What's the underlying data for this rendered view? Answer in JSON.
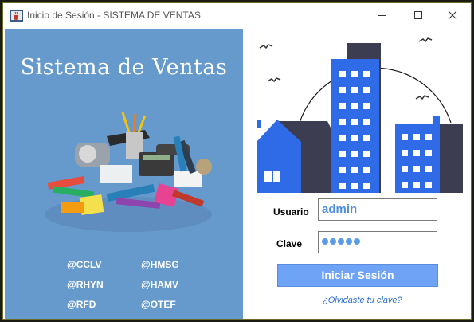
{
  "window": {
    "title": "Inicio de Sesión - SISTEMA DE VENTAS",
    "icon": "java-cup-icon",
    "controls": [
      "minimize-icon",
      "maximize-icon",
      "close-icon"
    ]
  },
  "left_panel": {
    "heading": "Sistema de Ventas",
    "illustration": "office-supplies-image",
    "background_color": "#6699cc",
    "credits": [
      "@CCLV",
      "@HMSG",
      "@RHYN",
      "@HAMV",
      "@RFD",
      "@OTEF"
    ]
  },
  "right_panel": {
    "illustration": "city-buildings-image"
  },
  "form": {
    "user_label": "Usuario",
    "user_value": "admin",
    "password_label": "Clave",
    "password_length": 5,
    "submit_label": "Iniciar Sesión",
    "forgot_link": "¿Olvidaste tu clave?"
  },
  "colors": {
    "accent": "#4f8fe0",
    "button": "#6fa3f5",
    "building_blue": "#2f6be6",
    "building_dark": "#3d3d52"
  }
}
